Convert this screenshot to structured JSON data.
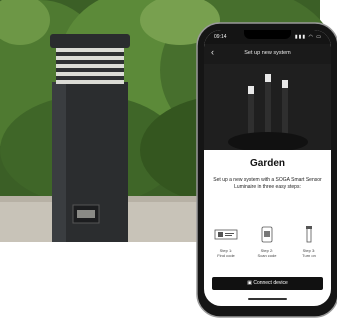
{
  "colors": {
    "foliage": "#3d6a2a",
    "bollard": "#2b2d2f",
    "pavement": "#c8c3b8",
    "phone_frame": "#151515",
    "screen_header": "#1a1a1a"
  },
  "photo": {
    "subject": "outdoor bollard light in a garden with hedge background"
  },
  "phone": {
    "status": {
      "time": "09:14",
      "signal": "▮▮▮ ◠ ▭"
    },
    "header": {
      "back_icon": "chevron-left-icon",
      "back": "‹",
      "title": "Set up new system"
    },
    "hero": {
      "subject": "three bollard lights"
    },
    "heading": "Garden",
    "description": "Set up a new system with a SOGA Smart Sensor Luminaire in three easy steps:",
    "steps": [
      {
        "label": "Step 1:\nFind code",
        "icon": "qr-code-icon"
      },
      {
        "label": "Step 2:\nScan code",
        "icon": "scan-icon"
      },
      {
        "label": "Step 3:\nTurn on",
        "icon": "bollard-icon"
      }
    ],
    "connect_button": "Connect device"
  }
}
